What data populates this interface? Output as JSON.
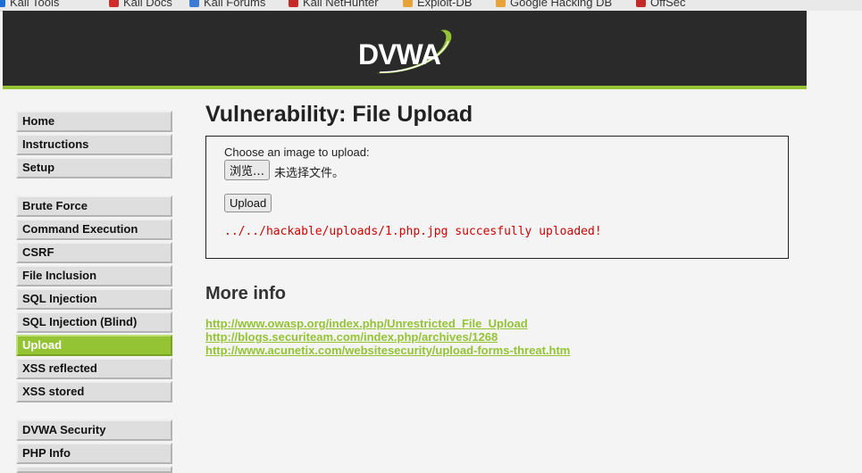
{
  "bookmarks": [
    {
      "label": "Kali Tools",
      "color": "#1e6fd1"
    },
    {
      "label": "Kali Docs",
      "color": "#d12c2c"
    },
    {
      "label": "Kali Forums",
      "color": "#3a7bd5"
    },
    {
      "label": "Kali NetHunter",
      "color": "#c62828"
    },
    {
      "label": "Exploit-DB",
      "color": "#e8a23a"
    },
    {
      "label": "Google Hacking DB",
      "color": "#e8a23a"
    },
    {
      "label": "OffSec",
      "color": "#c62828"
    }
  ],
  "header": {
    "logo_text": "DVWA",
    "accent_color": "#94c334"
  },
  "menu": {
    "group1": [
      "Home",
      "Instructions",
      "Setup"
    ],
    "group2": [
      "Brute Force",
      "Command Execution",
      "CSRF",
      "File Inclusion",
      "SQL Injection",
      "SQL Injection (Blind)",
      "Upload",
      "XSS reflected",
      "XSS stored"
    ],
    "group3": [
      "DVWA Security",
      "PHP Info"
    ],
    "selected": "Upload"
  },
  "main": {
    "title": "Vulnerability: File Upload",
    "form": {
      "choose_label": "Choose an image to upload:",
      "browse_label": "浏览…",
      "no_file_text": "未选择文件。",
      "upload_label": "Upload",
      "result_message": "../../hackable/uploads/1.php.jpg succesfully uploaded!"
    },
    "more_info_title": "More info",
    "links": [
      "http://www.owasp.org/index.php/Unrestricted_File_Upload",
      "http://blogs.securiteam.com/index.php/archives/1268",
      "http://www.acunetix.com/websitesecurity/upload-forms-threat.htm"
    ]
  }
}
